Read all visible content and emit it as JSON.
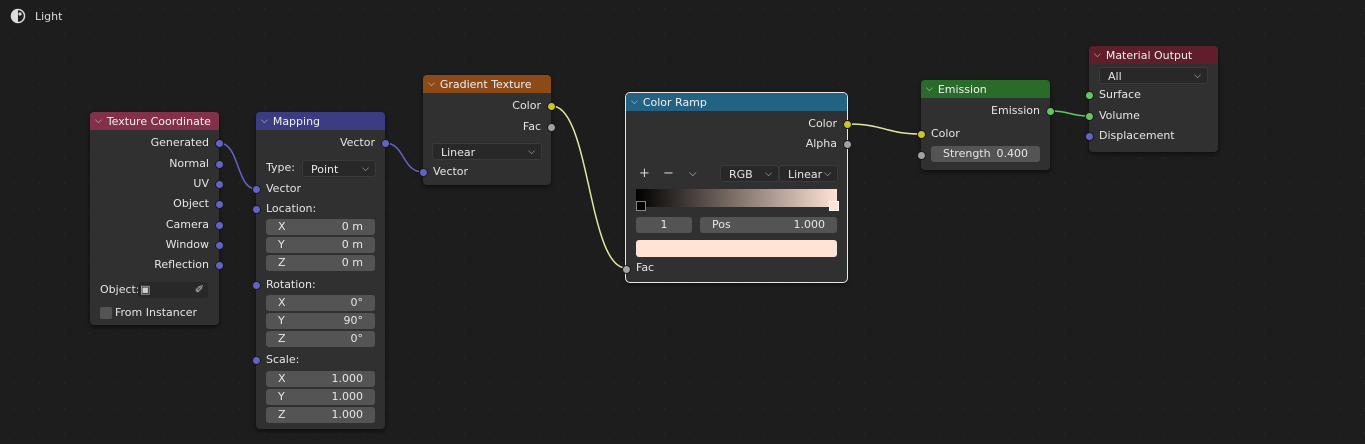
{
  "header": {
    "title": "Light",
    "icon": "shading-sphere-icon"
  },
  "colors": {
    "bg": "#1d1d1d",
    "node": "#303030",
    "vector_socket": "#6363c7",
    "color_socket": "#c7c729",
    "float_socket": "#a1a1a1",
    "shader_socket": "#63c763"
  },
  "tex_coord": {
    "title": "Texture Coordinate",
    "outputs": [
      "Generated",
      "Normal",
      "UV",
      "Object",
      "Camera",
      "Window",
      "Reflection"
    ],
    "object_label": "Object:",
    "from_instancer": "From Instancer"
  },
  "mapping": {
    "title": "Mapping",
    "output": "Vector",
    "type_label": "Type:",
    "type_value": "Point",
    "vector_in": "Vector",
    "location": {
      "label": "Location:",
      "x": "0 m",
      "y": "0 m",
      "z": "0 m"
    },
    "rotation": {
      "label": "Rotation:",
      "x": "0°",
      "y": "90°",
      "z": "0°"
    },
    "scale": {
      "label": "Scale:",
      "x": "1.000",
      "y": "1.000",
      "z": "1.000"
    },
    "axis_x": "X",
    "axis_y": "Y",
    "axis_z": "Z"
  },
  "gradient": {
    "title": "Gradient Texture",
    "out_color": "Color",
    "out_fac": "Fac",
    "mode": "Linear",
    "vector_in": "Vector"
  },
  "ramp": {
    "title": "Color Ramp",
    "out_color": "Color",
    "out_alpha": "Alpha",
    "add": "+",
    "remove": "−",
    "color_mode": "RGB",
    "interp": "Linear",
    "stop_index": "1",
    "pos_label": "Pos",
    "pos_value": "1.000",
    "stop_color": "#ffe3d5",
    "fac_in": "Fac"
  },
  "emission": {
    "title": "Emission",
    "out": "Emission",
    "color_in": "Color",
    "strength_label": "Strength",
    "strength_value": "0.400"
  },
  "output": {
    "title": "Material Output",
    "target": "All",
    "surface": "Surface",
    "volume": "Volume",
    "displacement": "Displacement"
  }
}
